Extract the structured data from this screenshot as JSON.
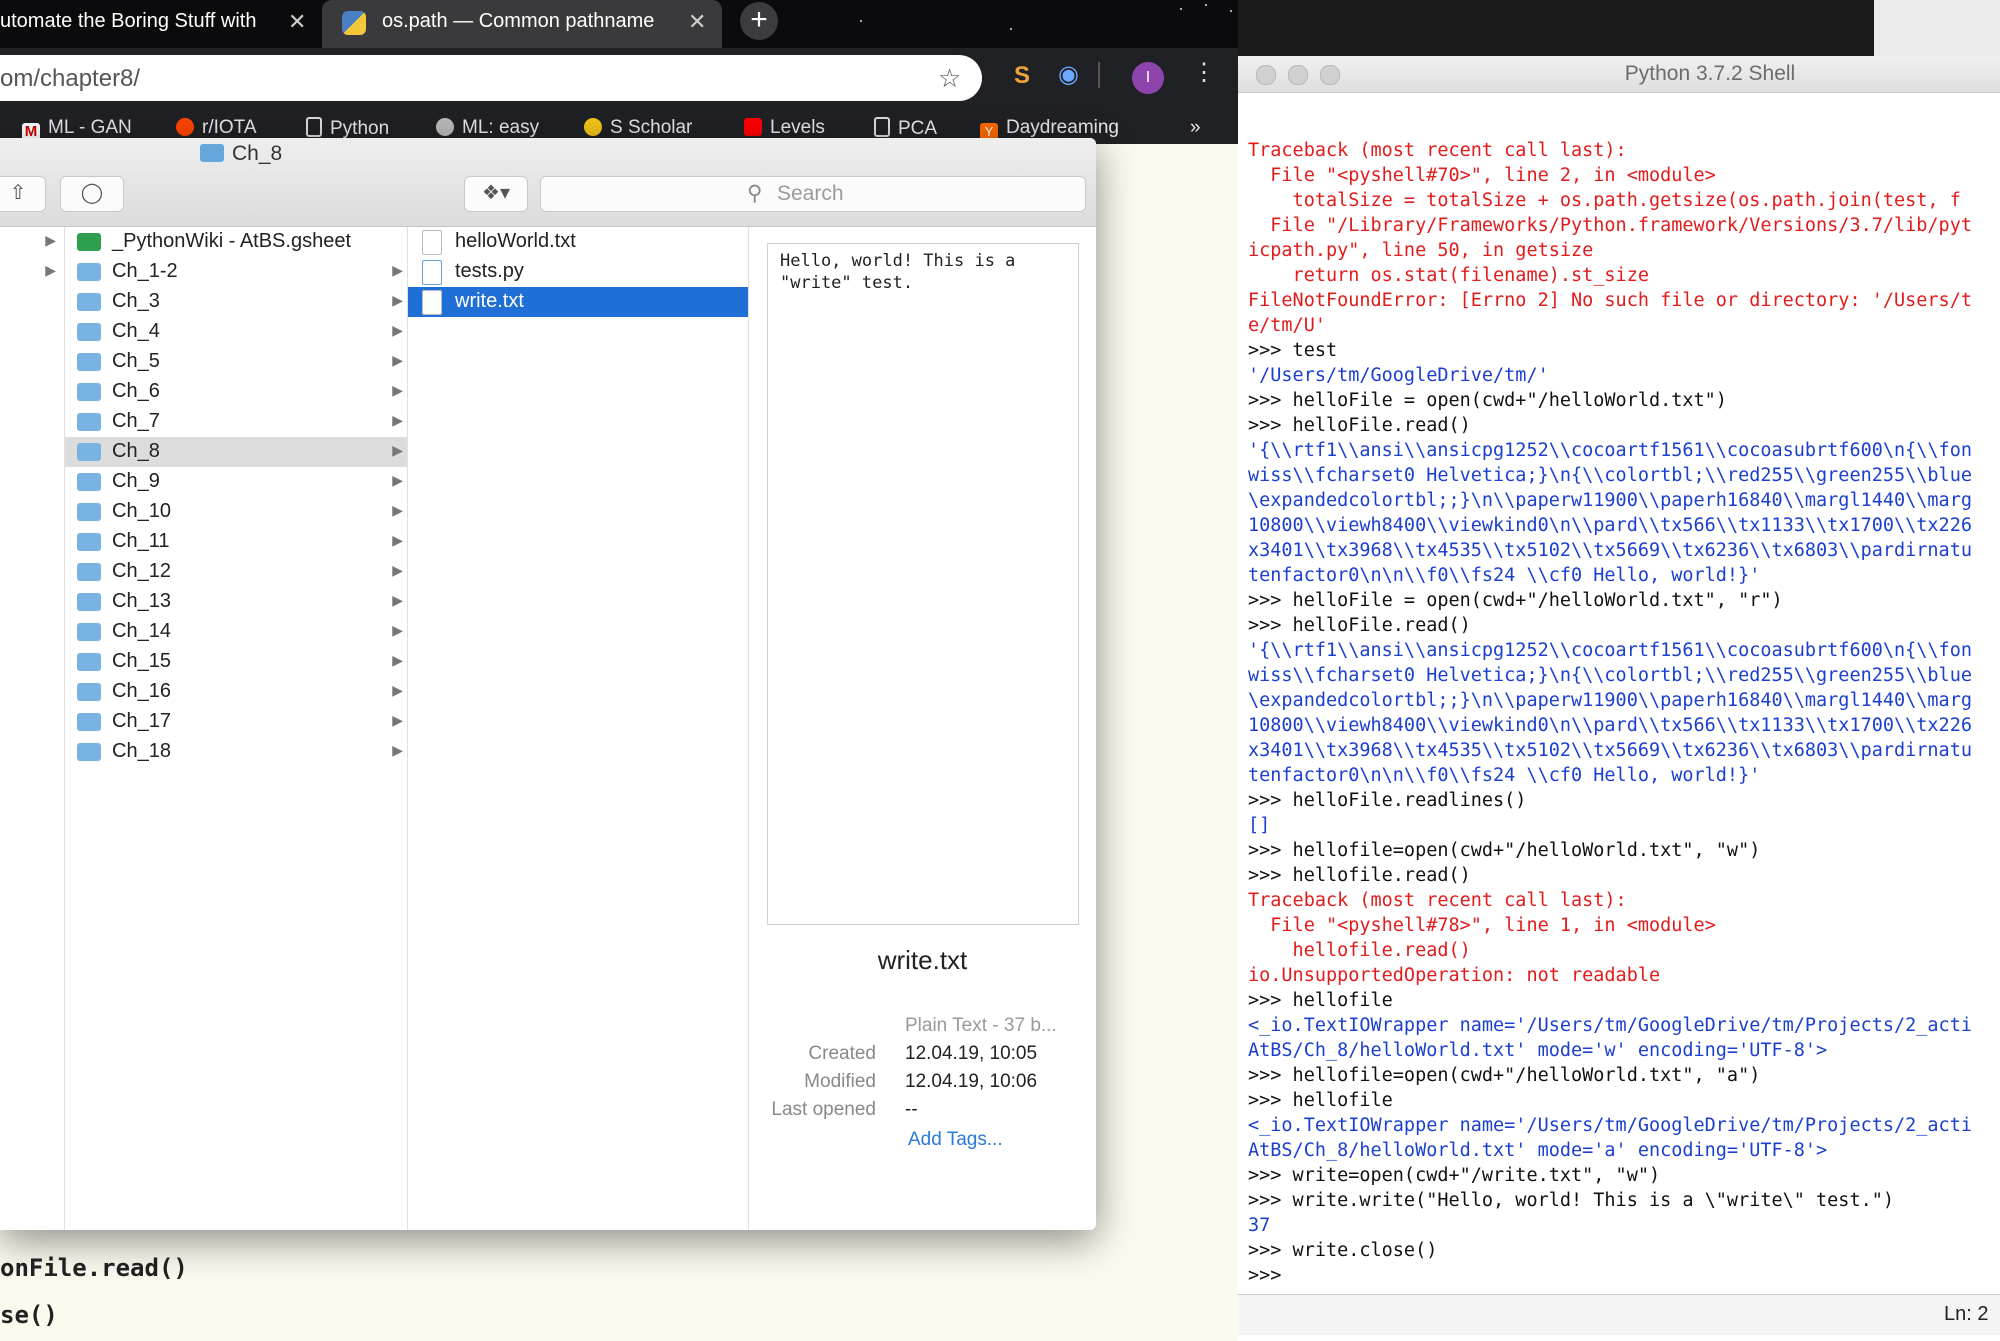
{
  "browser": {
    "tabs": [
      {
        "title": "Automate the Boring Stuff with",
        "visible": "utomate the Boring Stuff with"
      },
      {
        "title": "os.path — Common pathname"
      }
    ],
    "new_tab": "+",
    "url": "om/chapter8/",
    "bookmarks": [
      "ML - GAN",
      "r/IOTA",
      "Python",
      "ML: easy",
      "S Scholar",
      "Levels",
      "PCA",
      "Daydreaming"
    ],
    "more": "»",
    "page_code": [
      "onFile.read()",
      "se()"
    ]
  },
  "finder": {
    "title": "Ch_8",
    "search_placeholder": "Search",
    "col2_items": [
      {
        "label": "_PythonWiki - AtBS.gsheet",
        "kind": "gsheet"
      },
      {
        "label": "Ch_1-2"
      },
      {
        "label": "Ch_3"
      },
      {
        "label": "Ch_4"
      },
      {
        "label": "Ch_5"
      },
      {
        "label": "Ch_6"
      },
      {
        "label": "Ch_7"
      },
      {
        "label": "Ch_8",
        "selected": true
      },
      {
        "label": "Ch_9"
      },
      {
        "label": "Ch_10"
      },
      {
        "label": "Ch_11"
      },
      {
        "label": "Ch_12"
      },
      {
        "label": "Ch_13"
      },
      {
        "label": "Ch_14"
      },
      {
        "label": "Ch_15"
      },
      {
        "label": "Ch_16"
      },
      {
        "label": "Ch_17"
      },
      {
        "label": "Ch_18"
      }
    ],
    "col3_items": [
      {
        "label": "helloWorld.txt"
      },
      {
        "label": "tests.py"
      },
      {
        "label": "write.txt",
        "selected": true
      }
    ],
    "preview": {
      "content": "Hello, world! This is a\n\"write\" test.",
      "filename": "write.txt",
      "kind": "Plain Text - 37 b...",
      "created_label": "Created",
      "created": "12.04.19, 10:05",
      "modified_label": "Modified",
      "modified": "12.04.19, 10:06",
      "opened_label": "Last opened",
      "opened": "--",
      "add_tags": "Add Tags..."
    }
  },
  "shell": {
    "title": "Python 3.7.2 Shell",
    "lines": [
      {
        "t": "err",
        "s": "Traceback (most recent call last):"
      },
      {
        "t": "err",
        "s": "  File \"<pyshell#70>\", line 2, in <module>"
      },
      {
        "t": "err",
        "s": "    totalSize = totalSize + os.path.getsize(os.path.join(test, f"
      },
      {
        "t": "err",
        "s": "  File \"/Library/Frameworks/Python.framework/Versions/3.7/lib/pyt"
      },
      {
        "t": "err",
        "s": "icpath.py\", line 50, in getsize"
      },
      {
        "t": "err",
        "s": "    return os.stat(filename).st_size"
      },
      {
        "t": "err",
        "s": "FileNotFoundError: [Errno 2] No such file or directory: '/Users/t"
      },
      {
        "t": "err",
        "s": "e/tm/U'"
      },
      {
        "t": "in",
        "s": ">>> test"
      },
      {
        "t": "out",
        "s": "'/Users/tm/GoogleDrive/tm/'"
      },
      {
        "t": "in",
        "s": ">>> helloFile = open(cwd+\"/helloWorld.txt\")"
      },
      {
        "t": "in",
        "s": ">>> helloFile.read()"
      },
      {
        "t": "out",
        "s": "'{\\\\rtf1\\\\ansi\\\\ansicpg1252\\\\cocoartf1561\\\\cocoasubrtf600\\n{\\\\fon"
      },
      {
        "t": "out",
        "s": "wiss\\\\fcharset0 Helvetica;}\\n{\\\\colortbl;\\\\red255\\\\green255\\\\blue"
      },
      {
        "t": "out",
        "s": "\\expandedcolortbl;;}\\n\\\\paperw11900\\\\paperh16840\\\\margl1440\\\\marg"
      },
      {
        "t": "out",
        "s": "10800\\\\viewh8400\\\\viewkind0\\n\\\\pard\\\\tx566\\\\tx1133\\\\tx1700\\\\tx226"
      },
      {
        "t": "out",
        "s": "x3401\\\\tx3968\\\\tx4535\\\\tx5102\\\\tx5669\\\\tx6236\\\\tx6803\\\\pardirnatu"
      },
      {
        "t": "out",
        "s": "tenfactor0\\n\\n\\\\f0\\\\fs24 \\\\cf0 Hello, world!}'"
      },
      {
        "t": "in",
        "s": ">>> helloFile = open(cwd+\"/helloWorld.txt\", \"r\")"
      },
      {
        "t": "in",
        "s": ">>> helloFile.read()"
      },
      {
        "t": "out",
        "s": "'{\\\\rtf1\\\\ansi\\\\ansicpg1252\\\\cocoartf1561\\\\cocoasubrtf600\\n{\\\\fon"
      },
      {
        "t": "out",
        "s": "wiss\\\\fcharset0 Helvetica;}\\n{\\\\colortbl;\\\\red255\\\\green255\\\\blue"
      },
      {
        "t": "out",
        "s": "\\expandedcolortbl;;}\\n\\\\paperw11900\\\\paperh16840\\\\margl1440\\\\marg"
      },
      {
        "t": "out",
        "s": "10800\\\\viewh8400\\\\viewkind0\\n\\\\pard\\\\tx566\\\\tx1133\\\\tx1700\\\\tx226"
      },
      {
        "t": "out",
        "s": "x3401\\\\tx3968\\\\tx4535\\\\tx5102\\\\tx5669\\\\tx6236\\\\tx6803\\\\pardirnatu"
      },
      {
        "t": "out",
        "s": "tenfactor0\\n\\n\\\\f0\\\\fs24 \\\\cf0 Hello, world!}'"
      },
      {
        "t": "in",
        "s": ">>> helloFile.readlines()"
      },
      {
        "t": "out",
        "s": "[]"
      },
      {
        "t": "in",
        "s": ">>> hellofile=open(cwd+\"/helloWorld.txt\", \"w\")"
      },
      {
        "t": "in",
        "s": ">>> hellofile.read()"
      },
      {
        "t": "err",
        "s": "Traceback (most recent call last):"
      },
      {
        "t": "err",
        "s": "  File \"<pyshell#78>\", line 1, in <module>"
      },
      {
        "t": "err",
        "s": "    hellofile.read()"
      },
      {
        "t": "err",
        "s": "io.UnsupportedOperation: not readable"
      },
      {
        "t": "in",
        "s": ">>> hellofile"
      },
      {
        "t": "out",
        "s": "<_io.TextIOWrapper name='/Users/tm/GoogleDrive/tm/Projects/2_acti"
      },
      {
        "t": "out",
        "s": "AtBS/Ch_8/helloWorld.txt' mode='w' encoding='UTF-8'>"
      },
      {
        "t": "in",
        "s": ">>> hellofile=open(cwd+\"/helloWorld.txt\", \"a\")"
      },
      {
        "t": "in",
        "s": ">>> hellofile"
      },
      {
        "t": "out",
        "s": "<_io.TextIOWrapper name='/Users/tm/GoogleDrive/tm/Projects/2_acti"
      },
      {
        "t": "out",
        "s": "AtBS/Ch_8/helloWorld.txt' mode='a' encoding='UTF-8'>"
      },
      {
        "t": "in",
        "s": ">>> write=open(cwd+\"/write.txt\", \"w\")"
      },
      {
        "t": "in",
        "s": ">>> write.write(\"Hello, world! This is a \\\"write\\\" test.\")"
      },
      {
        "t": "out",
        "s": "37"
      },
      {
        "t": "in",
        "s": ">>> write.close()"
      },
      {
        "t": "in",
        "s": ">>> "
      }
    ],
    "status": "Ln: 2"
  },
  "colors": {
    "error": "#e21b1b",
    "output": "#1b3fd0",
    "selection": "#1f6fd6"
  }
}
